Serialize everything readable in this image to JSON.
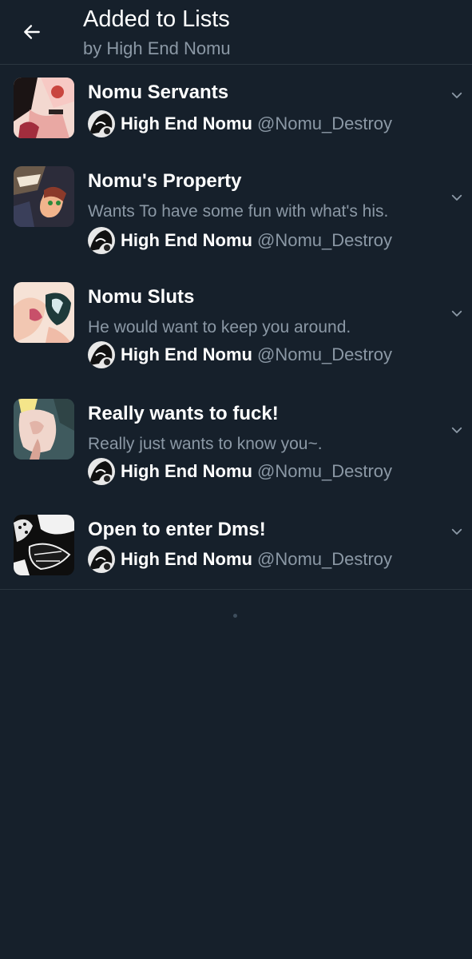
{
  "header": {
    "title": "Added to Lists",
    "subtitle": "by High End Nomu",
    "back_icon": "arrow-left-icon"
  },
  "lists": [
    {
      "title": "Nomu Servants",
      "description": "",
      "owner_name": "High End Nomu",
      "owner_handle": "@Nomu_Destroy"
    },
    {
      "title": "Nomu's Property",
      "description": "Wants To have some fun with what's his.",
      "owner_name": "High End Nomu",
      "owner_handle": "@Nomu_Destroy"
    },
    {
      "title": "Nomu Sluts",
      "description": "He would want to keep you around.",
      "owner_name": "High End Nomu",
      "owner_handle": "@Nomu_Destroy"
    },
    {
      "title": "Really wants to fuck!",
      "description": "Really just wants to know you~.",
      "owner_name": "High End Nomu",
      "owner_handle": "@Nomu_Destroy"
    },
    {
      "title": "Open to enter Dms!",
      "description": "",
      "owner_name": "High End Nomu",
      "owner_handle": "@Nomu_Destroy"
    }
  ],
  "colors": {
    "background": "#16202b",
    "secondary_text": "#8b98a5",
    "divider": "#2b3640"
  }
}
